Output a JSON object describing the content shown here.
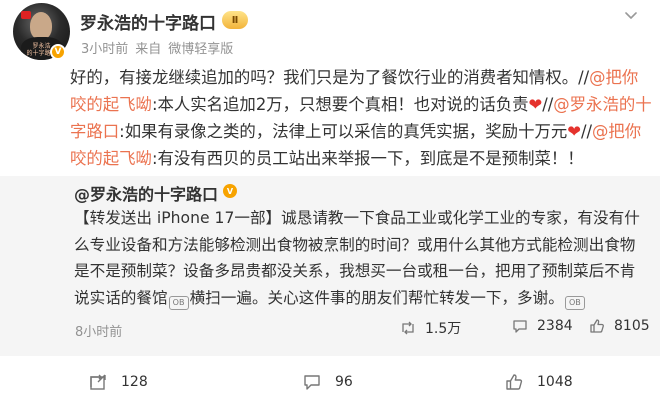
{
  "post": {
    "author": "罗永浩的十字路口",
    "level_badge": "Ⅱ",
    "verified_badge": "V",
    "avatar_text_line1": "罗永浩",
    "avatar_text_line2": "的十字路口",
    "time": "3小时前",
    "meta_source": "来自",
    "client": "微博轻享版",
    "text": {
      "p1": "好的，有接龙继续追加的吗？我们只是为了餐饮行业的消费者知情权。//",
      "l1": "@把你咬的起飞呦",
      "p2": ":本人实名追加2万，只想要个真相！也对说的话负责",
      "heart1": "❤",
      "p3": "//",
      "l2": "@罗永浩的十字路口",
      "p4": ":如果有录像之类的，法律上可以采信的真凭实据，奖励十万元",
      "heart2": "❤",
      "p5": "//",
      "l3": "@把你咬的起飞呦",
      "p6": ":有没有西贝的员工站出来举报一下，到底是不是预制菜！！"
    }
  },
  "quoted": {
    "author": "@罗永浩的十字路口",
    "verified_badge": "V",
    "text_a": "【转发送出 iPhone 17一部】诚恳请教一下食品工业或化学工业的专家，有没有什么专业设备和方法能够检测出食物被烹制的时间？或用什么其他方式能检测出食物是不是预制菜？设备多昂贵都没关系，我想买一台或租一台，把用了预制菜后不肯说实话的餐馆",
    "icon_label": "OB",
    "text_b": "横扫一遍。关心这件事的朋友们帮忙转发一下，多谢。",
    "time": "8小时前",
    "reposts": "1.5万",
    "comments": "2384",
    "likes": "8105"
  },
  "actions": {
    "reposts": "128",
    "comments": "96",
    "likes": "1048"
  },
  "colors": {
    "link": "#eb7350",
    "heart": "#e5322d",
    "meta_gray": "#939393",
    "quote_bg": "#f5f5f5",
    "badge_orange": "#f7a300"
  },
  "icons": [
    "chevron-down-icon",
    "verified-icon",
    "repost-icon",
    "comment-icon",
    "like-icon",
    "video-icon"
  ]
}
